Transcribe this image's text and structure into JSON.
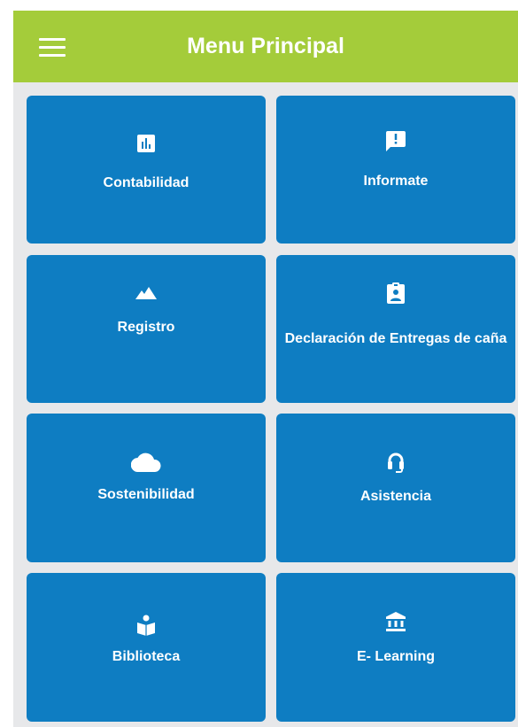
{
  "header": {
    "title": "Menu Principal"
  },
  "colors": {
    "header": "#a4cc3a",
    "background": "#e7e8ea",
    "tile": "#0e7dc2",
    "text": "#ffffff"
  },
  "menu": {
    "items": [
      {
        "label": "Contabilidad",
        "icon": "bar-chart-icon"
      },
      {
        "label": "Informate",
        "icon": "feedback-icon"
      },
      {
        "label": "Registro",
        "icon": "landscape-icon"
      },
      {
        "label": "Declaración de Entregas de caña",
        "icon": "assignment-ind-icon"
      },
      {
        "label": "Sostenibilidad",
        "icon": "cloud-icon"
      },
      {
        "label": "Asistencia",
        "icon": "headset-icon"
      },
      {
        "label": "Biblioteca",
        "icon": "local-library-icon"
      },
      {
        "label": "E- Learning",
        "icon": "account-balance-icon"
      }
    ]
  }
}
